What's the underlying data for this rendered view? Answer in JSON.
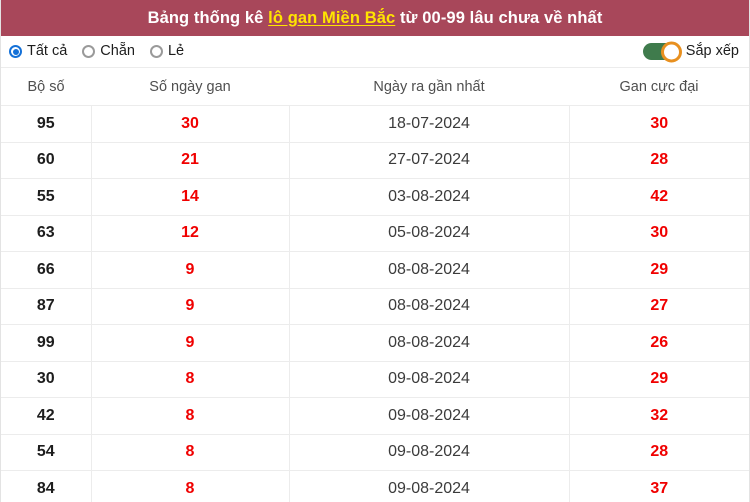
{
  "header": {
    "title_prefix": "Bảng thống kê ",
    "title_link": "lô gan Miền Bắc",
    "title_suffix": " từ 00-99 lâu chưa về nhất",
    "background_color": "#a8475a",
    "link_color": "#ffe400"
  },
  "controls": {
    "radios": [
      {
        "label": "Tất cả",
        "checked": true
      },
      {
        "label": "Chẵn",
        "checked": false
      },
      {
        "label": "Lẻ",
        "checked": false
      }
    ],
    "sort_toggle": {
      "label": "Sắp xếp",
      "state": "on",
      "track_color": "#3f7b4c",
      "knob_ring_color": "#e8901f"
    }
  },
  "table": {
    "columns": [
      "Bộ số",
      "Số ngày gan",
      "Ngày ra gần nhất",
      "Gan cực đại"
    ],
    "rows": [
      {
        "bo_so": "95",
        "so_ngay_gan": "30",
        "ngay_ra": "18-07-2024",
        "gan_cuc_dai": "30"
      },
      {
        "bo_so": "60",
        "so_ngay_gan": "21",
        "ngay_ra": "27-07-2024",
        "gan_cuc_dai": "28"
      },
      {
        "bo_so": "55",
        "so_ngay_gan": "14",
        "ngay_ra": "03-08-2024",
        "gan_cuc_dai": "42"
      },
      {
        "bo_so": "63",
        "so_ngay_gan": "12",
        "ngay_ra": "05-08-2024",
        "gan_cuc_dai": "30"
      },
      {
        "bo_so": "66",
        "so_ngay_gan": "9",
        "ngay_ra": "08-08-2024",
        "gan_cuc_dai": "29"
      },
      {
        "bo_so": "87",
        "so_ngay_gan": "9",
        "ngay_ra": "08-08-2024",
        "gan_cuc_dai": "27"
      },
      {
        "bo_so": "99",
        "so_ngay_gan": "9",
        "ngay_ra": "08-08-2024",
        "gan_cuc_dai": "26"
      },
      {
        "bo_so": "30",
        "so_ngay_gan": "8",
        "ngay_ra": "09-08-2024",
        "gan_cuc_dai": "29"
      },
      {
        "bo_so": "42",
        "so_ngay_gan": "8",
        "ngay_ra": "09-08-2024",
        "gan_cuc_dai": "32"
      },
      {
        "bo_so": "54",
        "so_ngay_gan": "8",
        "ngay_ra": "09-08-2024",
        "gan_cuc_dai": "28"
      },
      {
        "bo_so": "84",
        "so_ngay_gan": "8",
        "ngay_ra": "09-08-2024",
        "gan_cuc_dai": "37"
      }
    ]
  }
}
